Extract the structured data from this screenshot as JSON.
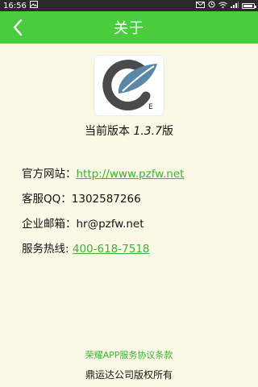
{
  "status_bar": {
    "time": "16:56",
    "icons": [
      "gallery-icon",
      "email-icon",
      "alarm-icon",
      "wifi-icon",
      "signal-icon",
      "battery-icon"
    ],
    "background": "#2a2a2a"
  },
  "app_bar": {
    "title": "关于",
    "color": "#4bcc3f"
  },
  "app": {
    "version_label": "当前版本",
    "version_number": "1.3.7",
    "version_suffix": "版"
  },
  "info": {
    "website_label": "官方网站：",
    "website_value": "http://www.pzfw.net",
    "qq_label": "客服QQ：",
    "qq_value": "1302587266",
    "email_label": "企业邮箱：",
    "email_value": "hr@pzfw.net",
    "hotline_label": "服务热线:",
    "hotline_value": "400-618-7518"
  },
  "footer": {
    "agreement": "荣耀APP服务协议条款",
    "copyright": "鼎运达公司版权所有"
  },
  "colors": {
    "accent": "#4bcc3f",
    "link": "#3cb23a",
    "page_background": "#fbf8e6"
  }
}
